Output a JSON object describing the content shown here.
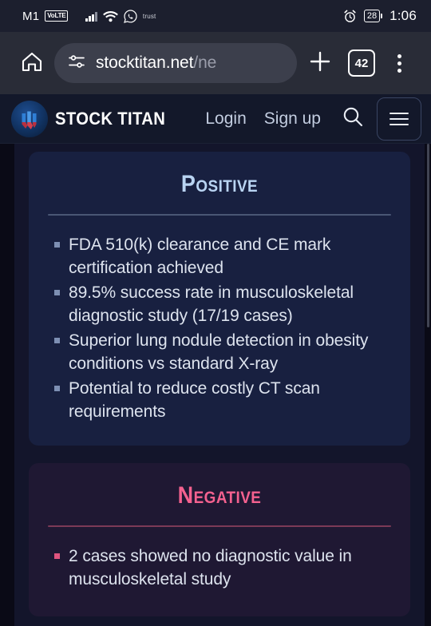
{
  "status_bar": {
    "carrier": "M1",
    "network_badge": "VoLTE",
    "signal_icon": "signal-bars-icon",
    "wifi_icon": "wifi-icon",
    "whatsapp_icon": "whatsapp-icon",
    "trust_label": "trust",
    "alarm_icon": "alarm-clock-icon",
    "battery_percent": "28",
    "time": "1:06"
  },
  "browser": {
    "home_icon": "home-icon",
    "site_settings_icon": "tune-settings-icon",
    "url_main": "stocktitan.net",
    "url_path": "/ne",
    "new_tab_icon": "plus-icon",
    "tab_count": "42",
    "overflow_menu_icon": "three-dot-menu-icon"
  },
  "site_header": {
    "logo_icon": "stock-titan-logo-icon",
    "brand": "STOCK TITAN",
    "login_label": "Login",
    "signup_label": "Sign up",
    "search_icon": "search-icon",
    "hamburger_icon": "hamburger-menu-icon"
  },
  "content": {
    "positive": {
      "title": "Positive",
      "items": [
        "FDA 510(k) clearance and CE mark certification achieved",
        "89.5% success rate in musculoskeletal diagnostic study (17/19 cases)",
        "Superior lung nodule detection in obesity conditions vs standard X-ray",
        "Potential to reduce costly CT scan requirements"
      ]
    },
    "negative": {
      "title": "Negative",
      "items": [
        "2 cases showed no diagnostic value in musculoskeletal study"
      ]
    }
  },
  "colors": {
    "positive_accent": "#b9d4f2",
    "negative_accent": "#f4618f",
    "page_background": "#13152b",
    "positive_card_bg": "#182040",
    "negative_card_bg": "#1f1833"
  }
}
